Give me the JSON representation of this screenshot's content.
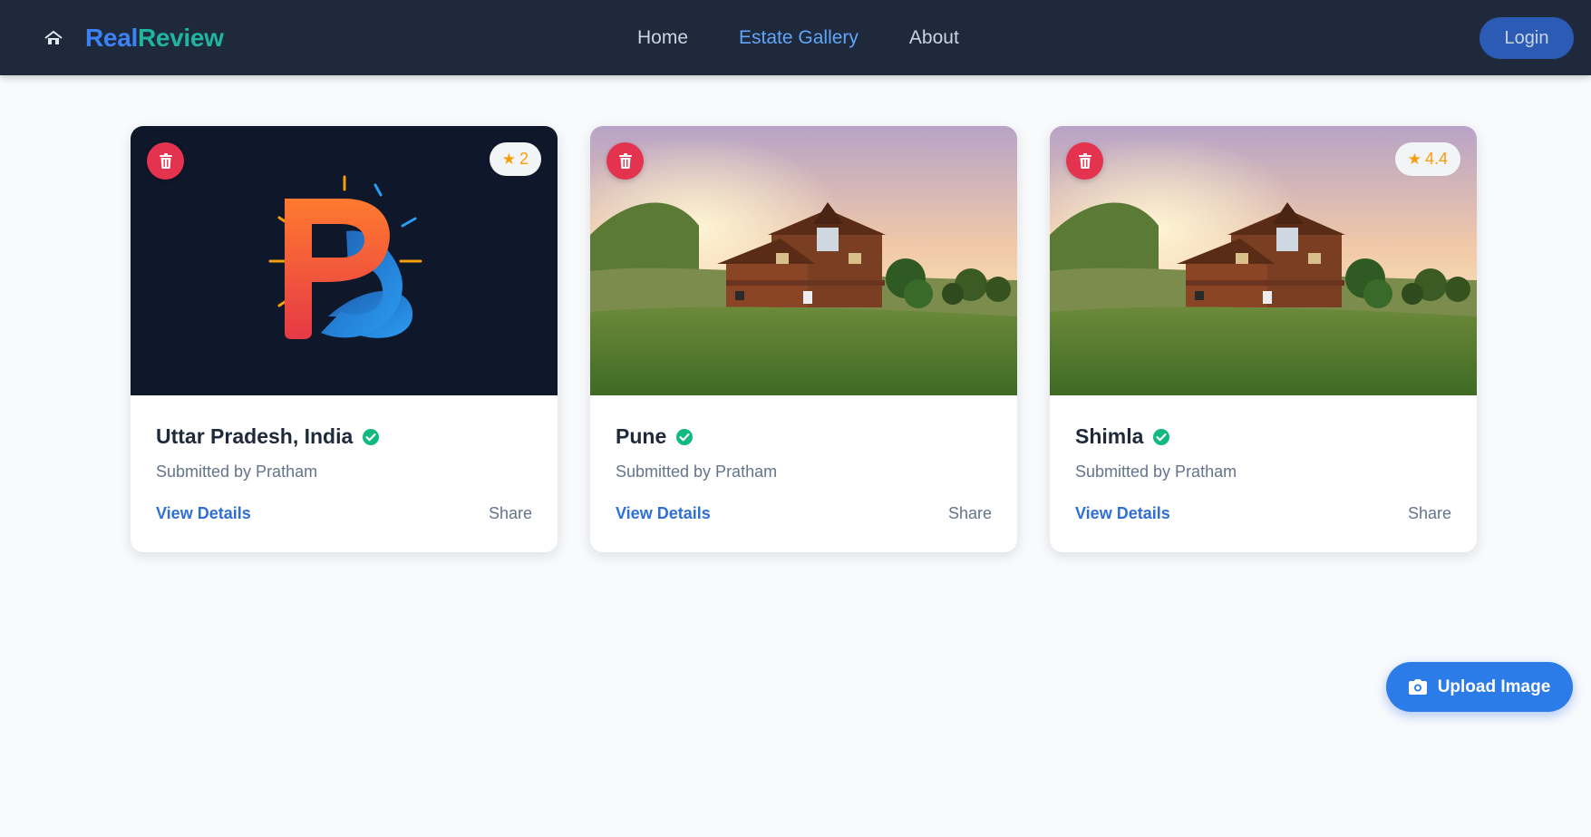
{
  "nav": {
    "brand_part1": "Real",
    "brand_part2": "Review",
    "links": [
      "Home",
      "Estate Gallery",
      "About"
    ],
    "active_link": "Estate Gallery",
    "login_label": "Login"
  },
  "cards": [
    {
      "title": "Uttar Pradesh, India",
      "submitted": "Submitted by Pratham",
      "rating": "2",
      "image": "pb-logo",
      "view_label": "View Details",
      "share_label": "Share"
    },
    {
      "title": "Pune",
      "submitted": "Submitted by Pratham",
      "rating": "",
      "image": "house-photo",
      "view_label": "View Details",
      "share_label": "Share"
    },
    {
      "title": "Shimla",
      "submitted": "Submitted by Pratham",
      "rating": "4.4",
      "image": "house-photo",
      "view_label": "View Details",
      "share_label": "Share"
    }
  ],
  "upload": {
    "label": "Upload Image"
  },
  "icons": {
    "brand": "house-icon",
    "delete": "trash-icon",
    "rating": "star-icon",
    "verified": "check-circle-icon",
    "upload": "camera-icon"
  },
  "colors": {
    "navbar": "#1e293b",
    "accent": "#3b82f6",
    "delete": "#e3334f",
    "verified": "#10b981",
    "star": "#f59e0b"
  }
}
